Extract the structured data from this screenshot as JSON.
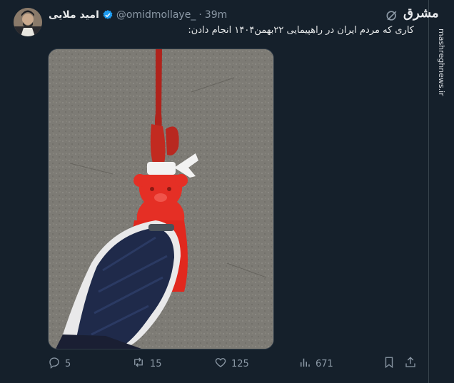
{
  "tweet": {
    "display_name": "امید ملایی",
    "handle": "@omidmollaye_",
    "separator": "·",
    "time": "39m",
    "text": "کاری که مردم ایران در راهپیمایی ۲۲بهمن۱۴۰۴ انجام دادن:"
  },
  "actions": {
    "replies": "5",
    "retweets": "15",
    "likes": "125",
    "views": "671"
  },
  "watermark": {
    "logo": "مشرق",
    "site": "mashreghnews.ir"
  },
  "icons": {
    "verified": "verified-badge-icon",
    "grok": "grok-icon",
    "reply": "reply-icon",
    "retweet": "retweet-icon",
    "like": "heart-icon",
    "views": "views-icon",
    "bookmark": "bookmark-icon",
    "share": "share-icon"
  },
  "colors": {
    "background": "#15202b",
    "verified": "#1d9bf0",
    "muted": "#8b98a5"
  }
}
